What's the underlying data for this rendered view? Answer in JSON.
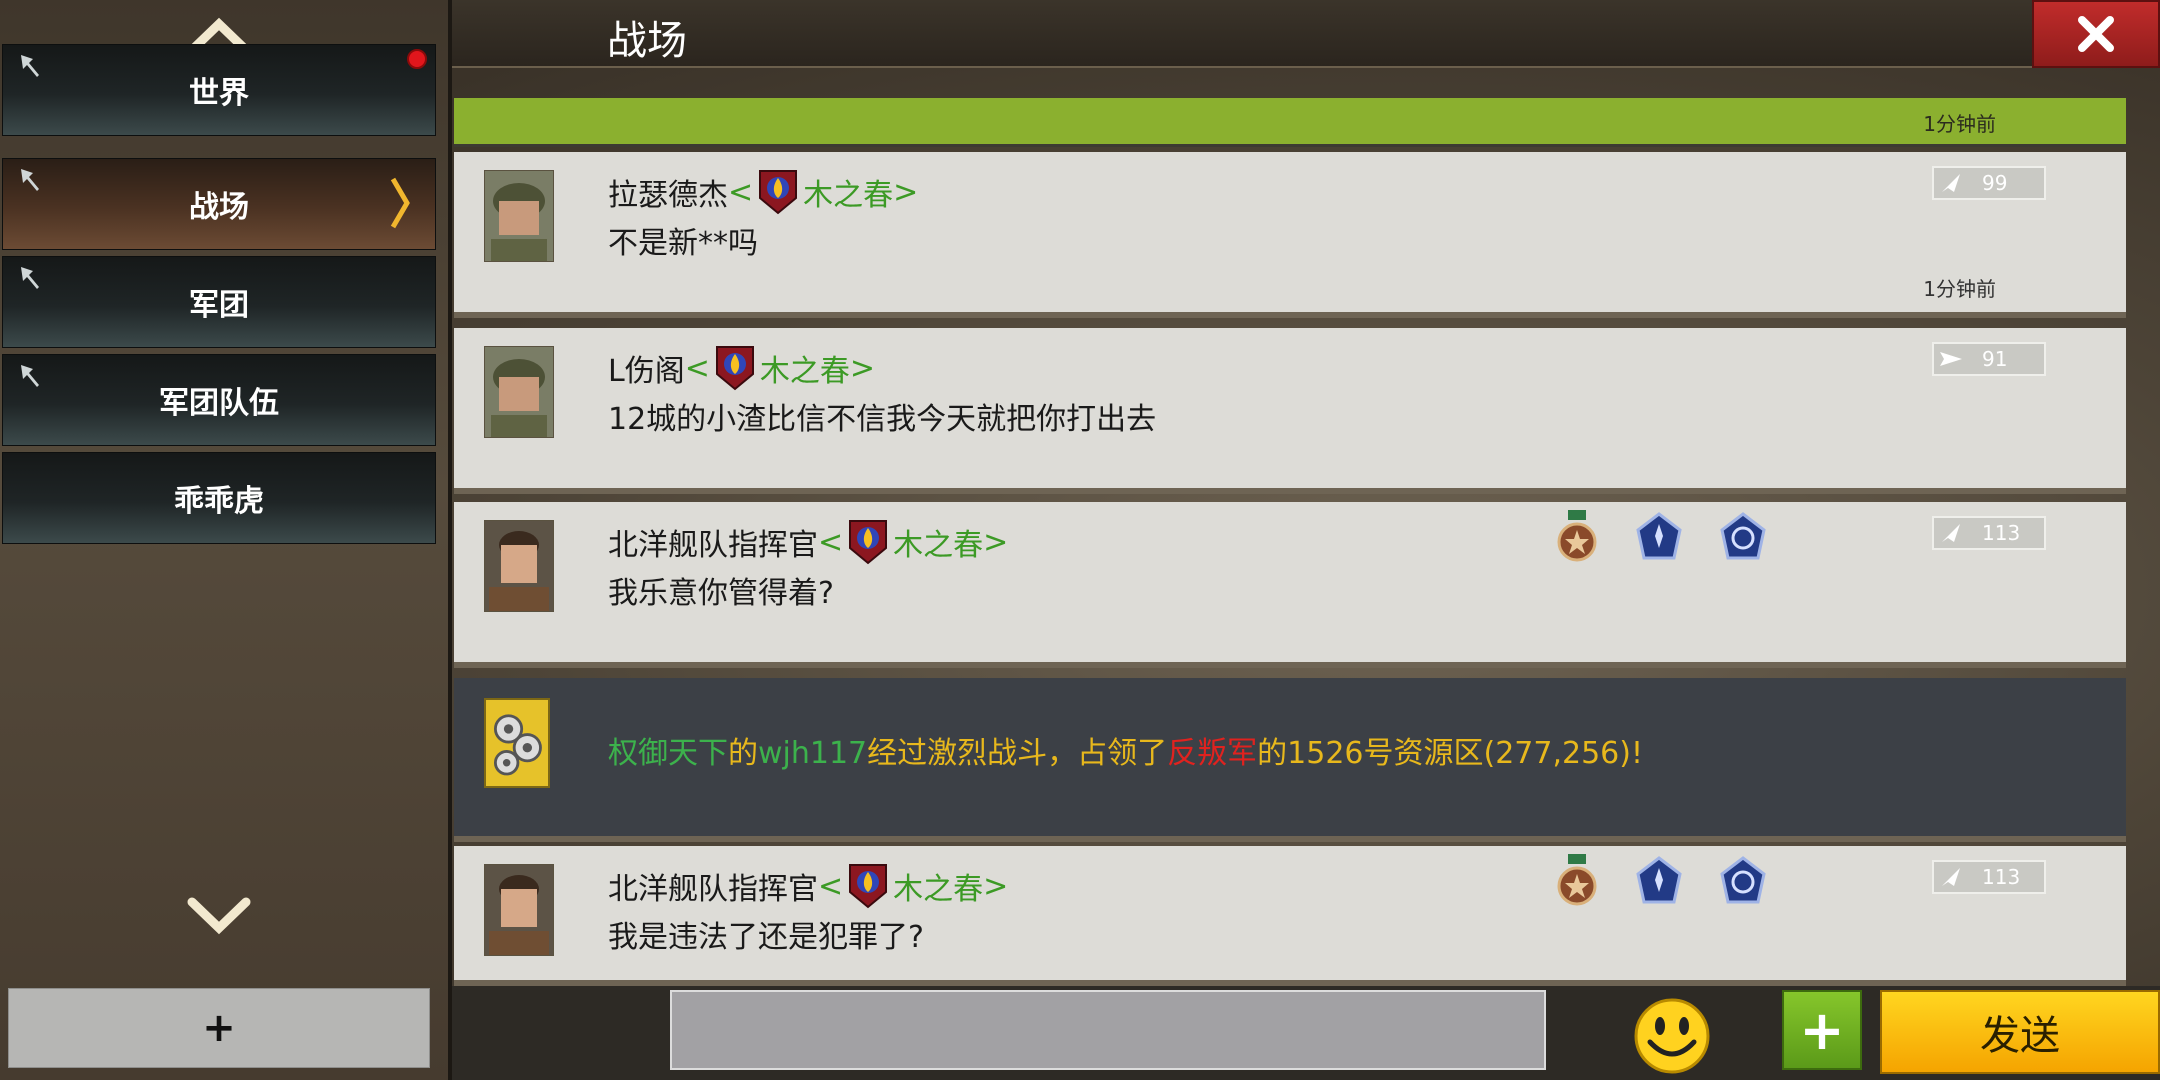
{
  "header": {
    "title": "战场",
    "close_label": "✕"
  },
  "sidebar": {
    "channels": [
      {
        "label": "世界",
        "pinned": true,
        "unread": true,
        "active": false
      },
      {
        "label": "战场",
        "pinned": true,
        "unread": false,
        "active": true
      },
      {
        "label": "军团",
        "pinned": true,
        "unread": false,
        "active": false
      },
      {
        "label": "军团队伍",
        "pinned": true,
        "unread": false,
        "active": false
      },
      {
        "label": "乖乖虎",
        "pinned": false,
        "unread": false,
        "active": false
      }
    ],
    "add_label": "+"
  },
  "messages": {
    "top_time": "1分钟前",
    "items": [
      {
        "user": "拉瑟德杰",
        "guild_open": "<",
        "guild": "木之春",
        "guild_close": ">",
        "text": "不是新**吗",
        "vip": "99",
        "time": "1分钟前",
        "medals": 0
      },
      {
        "user": "L伤阁",
        "guild_open": "<",
        "guild": "木之春",
        "guild_close": ">",
        "text": "12城的小渣比信不信我今天就把你打出去",
        "vip": "91",
        "time": "",
        "medals": 0
      },
      {
        "user": "北洋舰队指挥官",
        "guild_open": "<",
        "guild": "木之春",
        "guild_close": ">",
        "text": "我乐意你管得着?",
        "vip": "113",
        "time": "",
        "medals": 3
      },
      {
        "user": "北洋舰队指挥官",
        "guild_open": "<",
        "guild": "木之春",
        "guild_close": ">",
        "text": "我是违法了还是犯罪了?",
        "vip": "113",
        "time": "",
        "medals": 3
      }
    ],
    "system": {
      "part1": "权御天下",
      "part2": "的",
      "part3": "wjh117",
      "part4": "经过激烈战斗，占领了",
      "part5": "反叛军",
      "part6": "的1526号资源区(277,256)!"
    }
  },
  "bottom": {
    "input_value": "",
    "plus_label": "+",
    "send_label": "发送"
  },
  "colors": {
    "accent_green": "#8bb02f",
    "guild_green": "#3c9a25",
    "send_yellow": "#ffc20e",
    "close_red": "#b02625"
  }
}
